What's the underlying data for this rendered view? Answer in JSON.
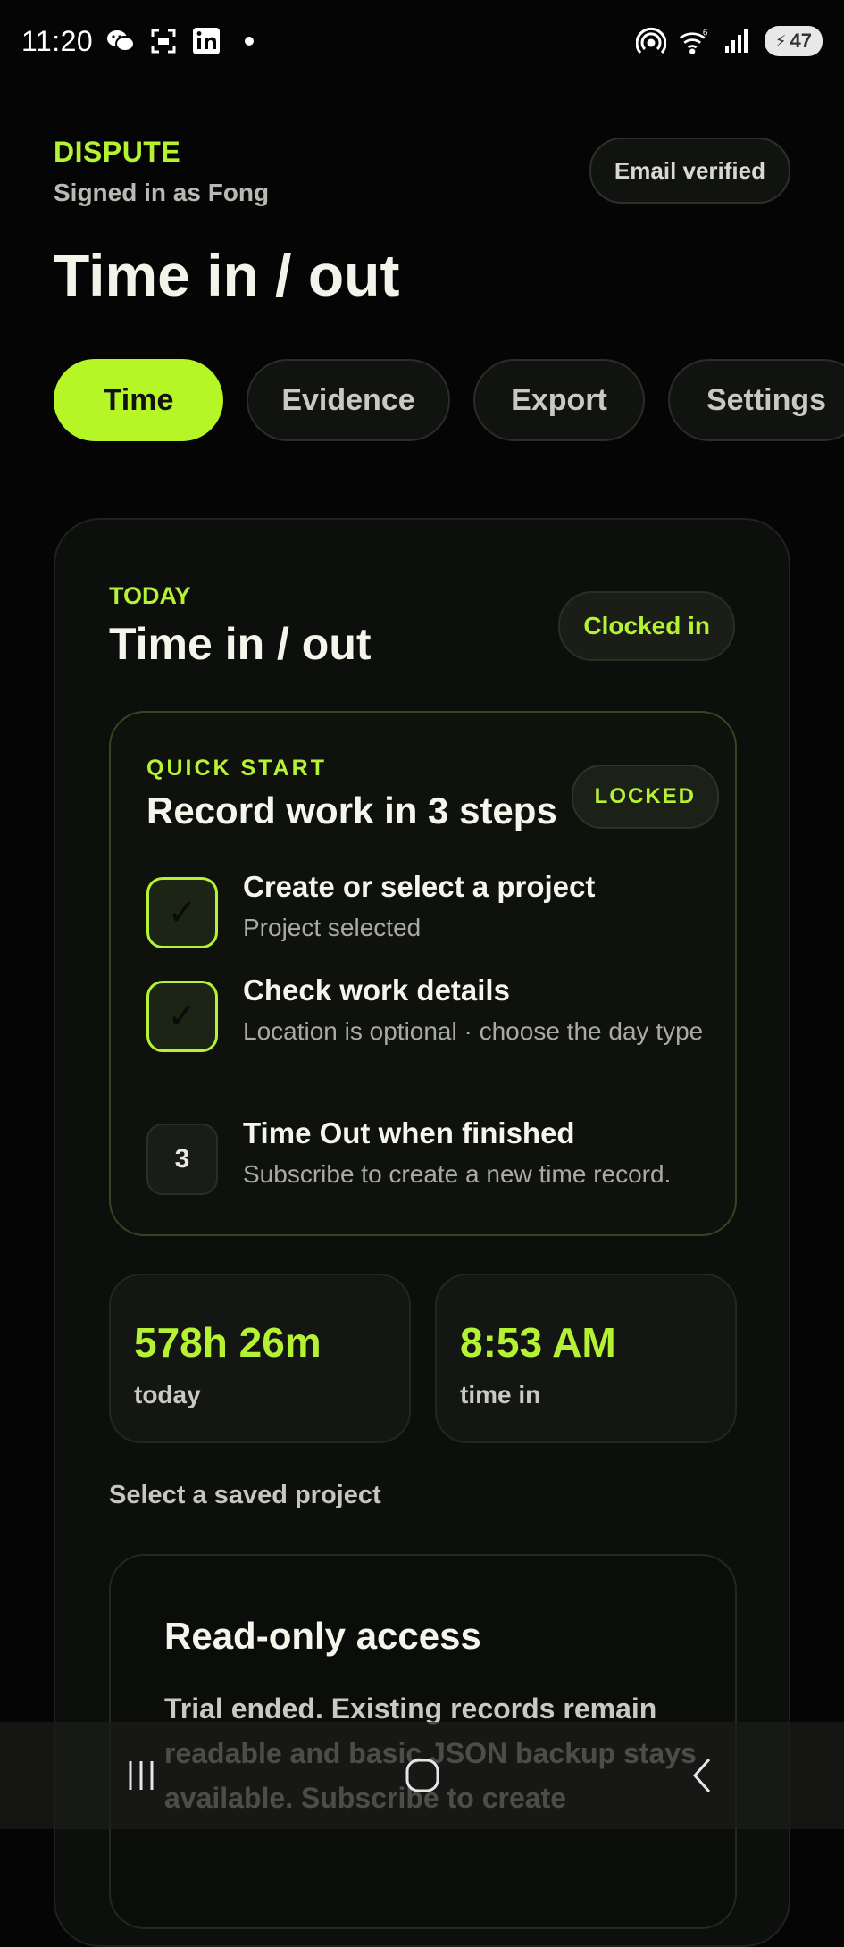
{
  "status_bar": {
    "time": "11:20",
    "battery": "47",
    "left_icons": [
      "wechat-icon",
      "scan-icon",
      "linkedin-icon",
      "dot-icon"
    ],
    "right_icons": [
      "hotspot-icon",
      "wifi-icon",
      "signal-icon",
      "battery-icon"
    ]
  },
  "header": {
    "brand": "DISPUTE",
    "signed_in": "Signed in as Fong",
    "email_badge": "Email verified",
    "title": "Time in / out"
  },
  "tabs": [
    {
      "label": "Time",
      "active": true
    },
    {
      "label": "Evidence",
      "active": false
    },
    {
      "label": "Export",
      "active": false
    },
    {
      "label": "Settings",
      "active": false
    }
  ],
  "today_card": {
    "eyebrow": "TODAY",
    "title": "Time in / out",
    "status": "Clocked in",
    "quick_start": {
      "eyebrow": "QUICK START",
      "title": "Record work in 3 steps",
      "badge": "LOCKED",
      "steps": [
        {
          "marker": "✓",
          "title": "Create or select a project",
          "sub": "Project selected",
          "done": true
        },
        {
          "marker": "✓",
          "title": "Check work details",
          "sub": "Location is optional · choose the day type",
          "done": true
        },
        {
          "marker": "3",
          "title": "Time Out when finished",
          "sub": "Subscribe to create a new time record.",
          "done": false
        }
      ]
    },
    "stats": [
      {
        "value": "578h 26m",
        "label": "today"
      },
      {
        "value": "8:53 AM",
        "label": "time in"
      }
    ],
    "select_label": "Select a saved project",
    "read_only": {
      "title": "Read-only access",
      "body": "Trial ended. Existing records remain readable and basic JSON backup stays available. Subscribe to create"
    }
  },
  "colors": {
    "accent": "#b6f234",
    "background": "#050505",
    "card": "#0d0f0d"
  }
}
